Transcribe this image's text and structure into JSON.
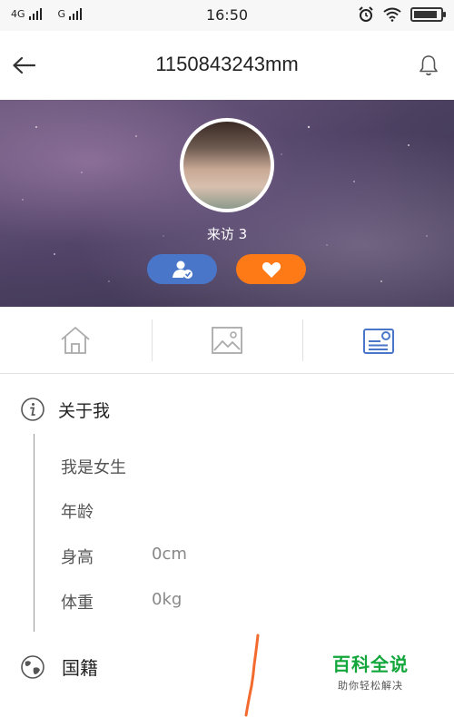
{
  "status_bar": {
    "network1": "4G",
    "network2": "G",
    "time": "16:50",
    "battery_level_fraction": 0.9
  },
  "header": {
    "back_icon": "arrow-left-icon",
    "title": "1150843243mm",
    "bell_icon": "bell-icon"
  },
  "profile": {
    "visits_label": "来访 3",
    "follow_icon": "user-check-icon",
    "like_icon": "heart-icon"
  },
  "tabs": [
    {
      "icon": "home-icon",
      "active": false
    },
    {
      "icon": "image-icon",
      "active": false
    },
    {
      "icon": "profile-card-icon",
      "active": true
    }
  ],
  "about": {
    "title": "关于我",
    "rows": [
      {
        "label": "我是女生",
        "value": ""
      },
      {
        "label": "年龄",
        "value": ""
      },
      {
        "label": "身高",
        "value": "0cm"
      },
      {
        "label": "体重",
        "value": "0kg"
      }
    ]
  },
  "nationality": {
    "label": "国籍",
    "icon": "globe-icon"
  },
  "watermark": {
    "title": "百科全说",
    "subtitle": "助你轻松解决"
  },
  "colors": {
    "accent_blue": "#4a76c9",
    "accent_orange": "#fe7a17",
    "watermark_green": "#12a63b",
    "scribble": "#f26a2e"
  }
}
